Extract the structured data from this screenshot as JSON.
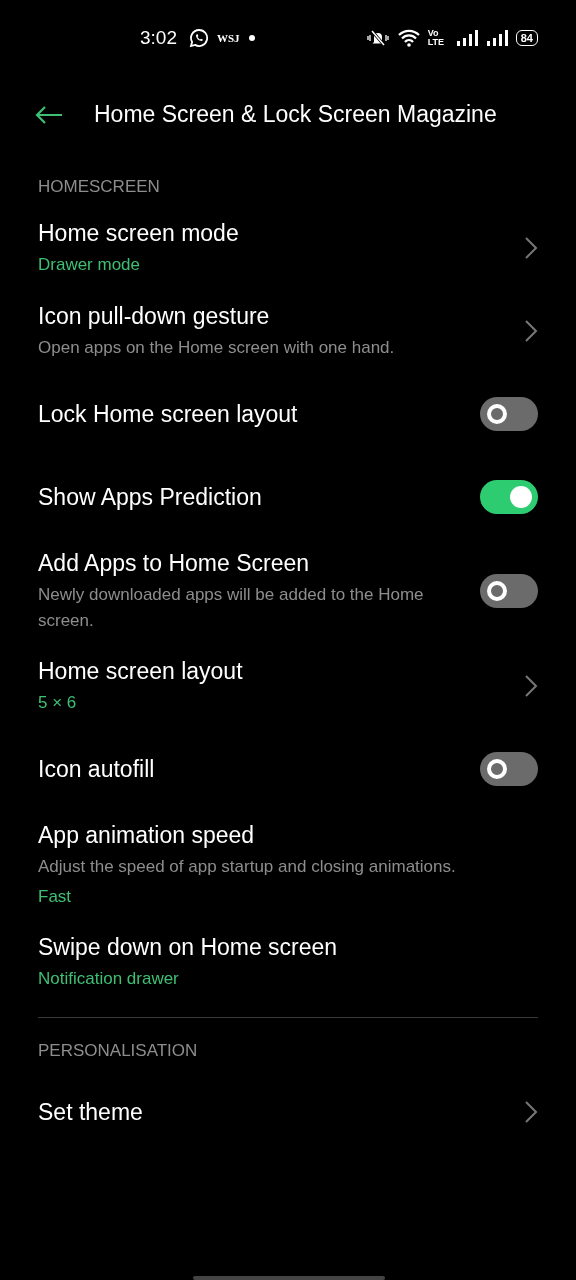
{
  "status_bar": {
    "time": "3:02",
    "notification_text": "WSJ",
    "network_label": "Vo LTE",
    "battery": "84"
  },
  "header": {
    "title": "Home Screen & Lock Screen Magazine"
  },
  "sections": [
    {
      "title": "HOMESCREEN",
      "items": [
        {
          "kind": "link",
          "title": "Home screen mode",
          "value": "Drawer mode"
        },
        {
          "kind": "link",
          "title": "Icon pull-down gesture",
          "description": "Open apps on the Home screen with one hand."
        },
        {
          "kind": "toggle",
          "title": "Lock Home screen layout",
          "on": false
        },
        {
          "kind": "toggle",
          "title": "Show Apps Prediction",
          "on": true
        },
        {
          "kind": "toggle",
          "title": "Add Apps to Home Screen",
          "description": "Newly downloaded apps will be added to the Home screen.",
          "on": false
        },
        {
          "kind": "link",
          "title": "Home screen layout",
          "value": "5 × 6"
        },
        {
          "kind": "toggle",
          "title": "Icon autofill",
          "on": false
        },
        {
          "kind": "plain",
          "title": "App animation speed",
          "description": "Adjust the speed of app startup and closing animations.",
          "value": "Fast"
        },
        {
          "kind": "plain",
          "title": "Swipe down on Home screen",
          "value": "Notification drawer"
        }
      ]
    },
    {
      "title": "PERSONALISATION",
      "items": [
        {
          "kind": "link",
          "title": "Set theme"
        }
      ]
    }
  ]
}
